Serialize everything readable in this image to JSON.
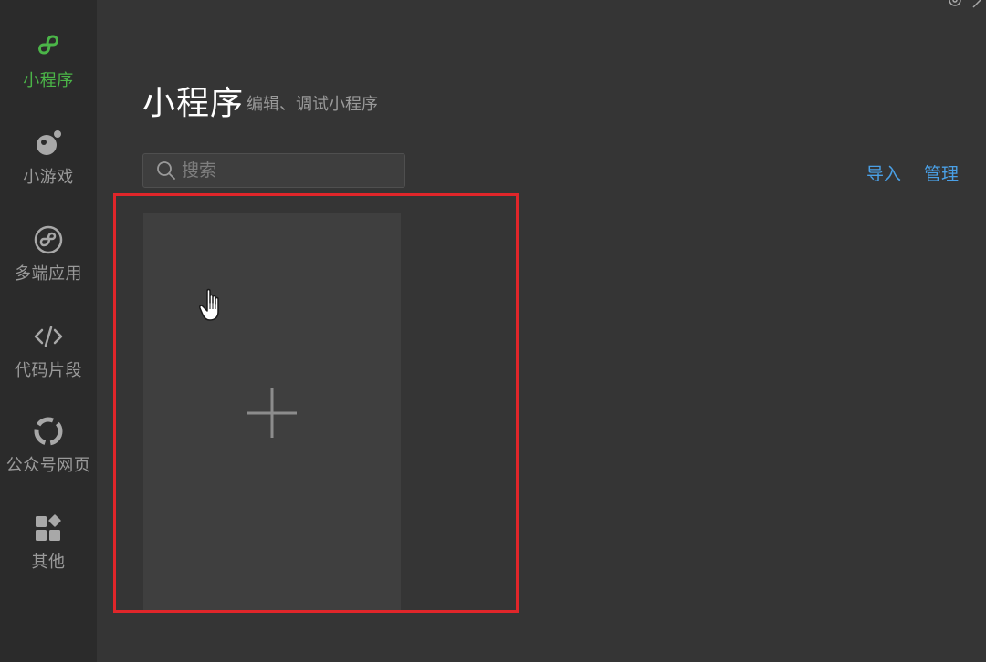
{
  "sidebar": {
    "items": [
      {
        "label": "小程序",
        "icon": "mini-program-icon",
        "active": true
      },
      {
        "label": "小游戏",
        "icon": "mini-game-icon",
        "active": false
      },
      {
        "label": "多端应用",
        "icon": "multi-platform-icon",
        "active": false
      },
      {
        "label": "代码片段",
        "icon": "code-snippet-icon",
        "active": false
      },
      {
        "label": "公众号网页",
        "icon": "official-account-icon",
        "active": false
      },
      {
        "label": "其他",
        "icon": "others-icon",
        "active": false
      }
    ]
  },
  "header": {
    "title": "小程序",
    "subtitle": "编辑、调试小程序"
  },
  "search": {
    "placeholder": "搜索",
    "value": ""
  },
  "actions": {
    "import_label": "导入",
    "manage_label": "管理"
  },
  "colors": {
    "accent_green": "#4bb548",
    "link_blue": "#4aa0e6",
    "highlight_red": "#e0262a",
    "sidebar_bg": "#2b2b2b",
    "main_bg": "#353535"
  }
}
